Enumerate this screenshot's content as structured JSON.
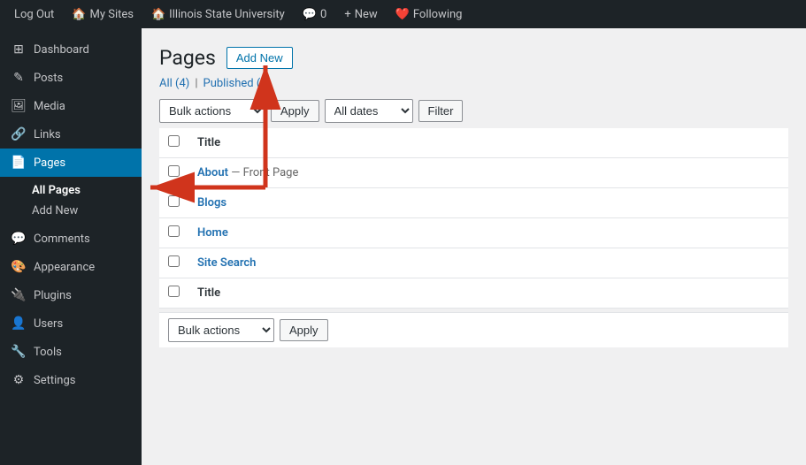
{
  "adminbar": {
    "logout_label": "Log Out",
    "my_sites_label": "My Sites",
    "site_name": "Illinois State University",
    "comments_count": "0",
    "new_label": "New",
    "following_label": "Following"
  },
  "sidebar": {
    "items": [
      {
        "id": "dashboard",
        "label": "Dashboard",
        "icon": "⊞"
      },
      {
        "id": "posts",
        "label": "Posts",
        "icon": "✎"
      },
      {
        "id": "media",
        "label": "Media",
        "icon": "🖼"
      },
      {
        "id": "links",
        "label": "Links",
        "icon": "🔗"
      },
      {
        "id": "pages",
        "label": "Pages",
        "icon": "📄",
        "active": true
      }
    ],
    "pages_sub": [
      {
        "id": "all-pages",
        "label": "All Pages",
        "active": true
      },
      {
        "id": "add-new",
        "label": "Add New",
        "active": false
      }
    ],
    "items2": [
      {
        "id": "comments",
        "label": "Comments",
        "icon": "💬"
      },
      {
        "id": "appearance",
        "label": "Appearance",
        "icon": "🎨"
      },
      {
        "id": "plugins",
        "label": "Plugins",
        "icon": "🔌"
      },
      {
        "id": "users",
        "label": "Users",
        "icon": "👤"
      },
      {
        "id": "tools",
        "label": "Tools",
        "icon": "🔧"
      },
      {
        "id": "settings",
        "label": "Settings",
        "icon": "⚙"
      }
    ]
  },
  "main": {
    "page_title": "Pages",
    "add_new_label": "Add New",
    "filter_links": [
      {
        "id": "all",
        "label": "All",
        "count": "(4)",
        "active": true
      },
      {
        "id": "published",
        "label": "Published",
        "count": "(4)",
        "active": false
      }
    ],
    "bulk_actions_label": "Bulk actions",
    "apply_label": "Apply",
    "date_filter": "All dates",
    "filter_label": "Filter",
    "table_header": "Title",
    "pages": [
      {
        "id": 1,
        "title": "About",
        "suffix": "— Front Page"
      },
      {
        "id": 2,
        "title": "Blogs",
        "suffix": ""
      },
      {
        "id": 3,
        "title": "Home",
        "suffix": ""
      },
      {
        "id": 4,
        "title": "Site Search",
        "suffix": ""
      }
    ],
    "bottom_title_col": "Title",
    "bottom_bulk_label": "Bulk actions",
    "bottom_apply_label": "Apply"
  }
}
